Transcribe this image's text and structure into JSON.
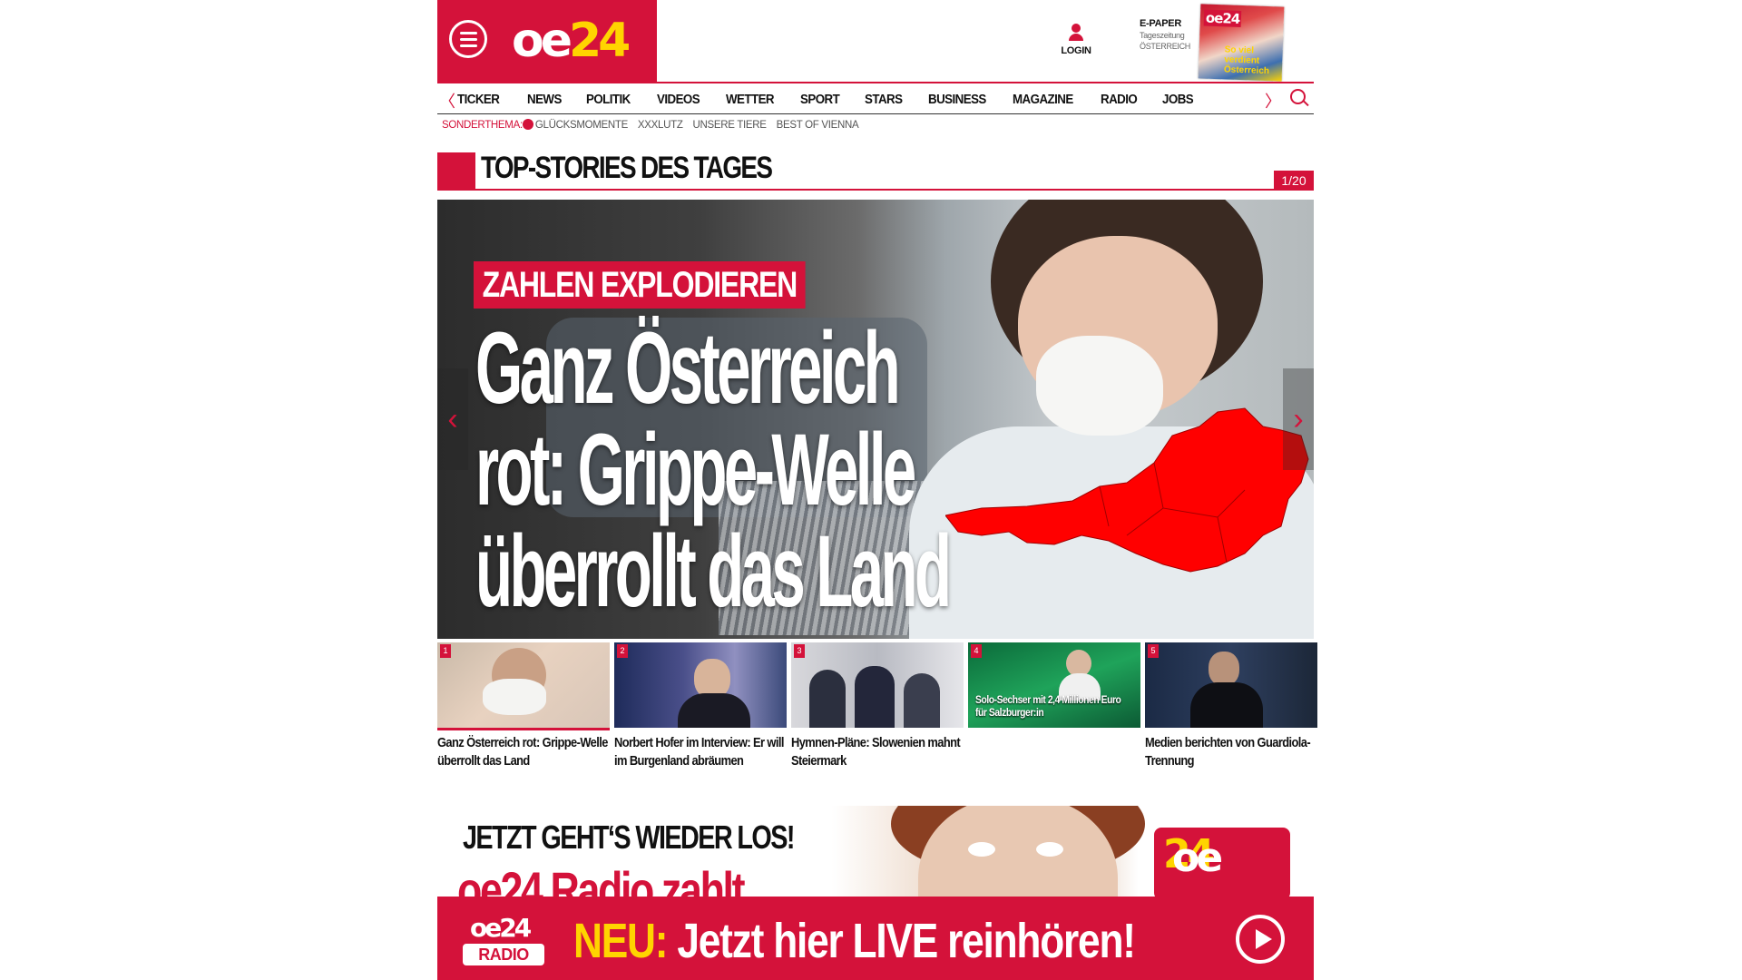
{
  "header": {
    "logo": {
      "part1": "oe",
      "part2": "24"
    },
    "login_label": "LOGIN",
    "epaper": {
      "title": "E-PAPER",
      "line1": "Tageszeitung",
      "line2": "ÖSTERREICH"
    },
    "epaper_thumb": {
      "logo": "oe24",
      "headline": "So viel verdient Österreich"
    }
  },
  "nav": {
    "items": [
      "TICKER",
      "NEWS",
      "POLITIK",
      "VIDEOS",
      "WETTER",
      "SPORT",
      "STARS",
      "BUSINESS",
      "MAGAZINE",
      "RADIO",
      "JOBS"
    ],
    "prev_icon": "chevron-left-icon",
    "next_icon": "chevron-right-icon",
    "search_icon": "search-icon"
  },
  "subnav": {
    "label": "SONDERTHEMA:",
    "items": [
      "GLÜCKSMOMENTE",
      "XXXLUTZ",
      "UNSERE TIERE",
      "BEST OF VIENNA"
    ]
  },
  "top_stories": {
    "title": "TOP-STORIES DES TAGES",
    "counter": "1/20"
  },
  "hero": {
    "kicker": "ZAHLEN EXPLODIEREN",
    "headline_l1": "Ganz Österreich",
    "headline_l2": "rot: Grippe-Welle",
    "headline_l3": "überrollt das Land",
    "prev": "‹",
    "next": "›"
  },
  "thumbs": [
    {
      "num": "1",
      "caption": "Ganz Österreich rot: Grippe-Welle überrollt das Land",
      "overlay": ""
    },
    {
      "num": "2",
      "caption": "Norbert Hofer im Interview: Er will im Burgenland abräumen",
      "overlay": ""
    },
    {
      "num": "3",
      "caption": "Hymnen-Pläne: Slowenien mahnt Steiermark",
      "overlay": ""
    },
    {
      "num": "4",
      "caption": "",
      "overlay": "Solo-Sechser mit 2,4 Millionen Euro für Salzburger:in"
    },
    {
      "num": "5",
      "caption": "Medien berichten von Guardiola-Trennung",
      "overlay": ""
    }
  ],
  "ad": {
    "line1": "JETZT GEHT‘S WIEDER LOS!",
    "line2": "oe24 Radio zahlt",
    "logo": {
      "part1": "oe",
      "part2": "24"
    }
  },
  "radio_bar": {
    "logo_top": "oe24",
    "logo_bottom": "RADIO",
    "highlight": "NEU:",
    "text": " Jetzt hier LIVE reinhören!",
    "play_icon": "play-icon"
  },
  "colors": {
    "brand_red": "#d4123a",
    "brand_yellow": "#ffd400"
  }
}
